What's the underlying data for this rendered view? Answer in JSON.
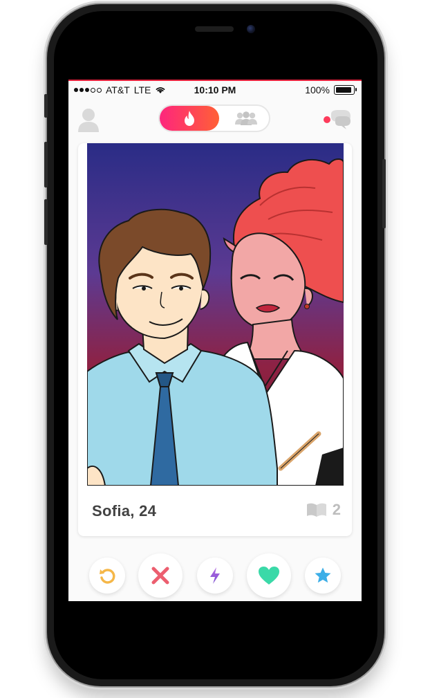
{
  "status_bar": {
    "carrier": "AT&T",
    "network": "LTE",
    "time": "10:10 PM",
    "battery_percent": "100%",
    "signal_bars_filled": 3,
    "signal_bars_total": 5
  },
  "top_nav": {
    "left_icon": "profile-icon",
    "toggle_active_icon": "flame-icon",
    "toggle_inactive_icon": "group-icon",
    "right_icon": "messages-icon",
    "has_notification": true
  },
  "card": {
    "name_age": "Sofia, 24",
    "photo_count": "2",
    "photo_count_icon": "book-icon"
  },
  "actions": [
    {
      "icon": "rewind-icon",
      "color": "#f5b748"
    },
    {
      "icon": "nope-icon",
      "color": "#ec5e6f"
    },
    {
      "icon": "boost-icon",
      "color": "#915dd1"
    },
    {
      "icon": "like-icon",
      "color": "#3ad9a8"
    },
    {
      "icon": "super-like-icon",
      "color": "#3caee7"
    }
  ],
  "colors": {
    "brand_gradient_start": "#fd267d",
    "brand_gradient_end": "#ff6036",
    "status_line": "#e8223d",
    "name_text": "#424242"
  }
}
